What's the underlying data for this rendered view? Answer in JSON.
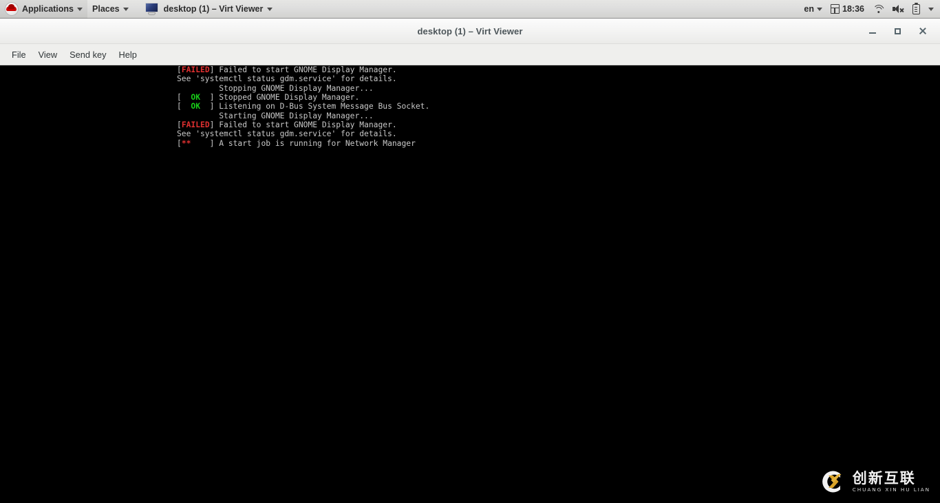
{
  "panel": {
    "logo_icon": "redhat-icon",
    "applications_label": "Applications",
    "places_label": "Places",
    "taskbar": {
      "icon": "monitor-icon",
      "label": "desktop (1) – Virt Viewer"
    },
    "tray": {
      "language": "en",
      "calendar_icon": "calendar-icon",
      "clock": "18:36",
      "wifi_icon": "wifi-icon",
      "volume_icon": "speaker-muted-icon",
      "battery_icon": "battery-icon",
      "menu_icon": "chevron-down-icon"
    }
  },
  "window": {
    "title": "desktop (1) – Virt Viewer",
    "controls": {
      "minimize": "minimize-icon",
      "maximize": "maximize-icon",
      "close": "close-icon"
    },
    "menus": [
      {
        "label": "File"
      },
      {
        "label": "View"
      },
      {
        "label": "Send key"
      },
      {
        "label": "Help"
      }
    ]
  },
  "console": {
    "lines": [
      {
        "segments": [
          {
            "text": "[",
            "style": "plain"
          },
          {
            "text": "FAILED",
            "style": "failed"
          },
          {
            "text": "] Failed to start GNOME Display Manager.",
            "style": "plain"
          }
        ]
      },
      {
        "segments": [
          {
            "text": "See 'systemctl status gdm.service' for details.",
            "style": "plain"
          }
        ]
      },
      {
        "segments": [
          {
            "text": "         Stopping GNOME Display Manager...",
            "style": "plain"
          }
        ]
      },
      {
        "segments": [
          {
            "text": "[  ",
            "style": "plain"
          },
          {
            "text": "OK",
            "style": "ok"
          },
          {
            "text": "  ] Stopped GNOME Display Manager.",
            "style": "plain"
          }
        ]
      },
      {
        "segments": [
          {
            "text": "[  ",
            "style": "plain"
          },
          {
            "text": "OK",
            "style": "ok"
          },
          {
            "text": "  ] Listening on D-Bus System Message Bus Socket.",
            "style": "plain"
          }
        ]
      },
      {
        "segments": [
          {
            "text": "         Starting GNOME Display Manager...",
            "style": "plain"
          }
        ]
      },
      {
        "segments": [
          {
            "text": "[",
            "style": "plain"
          },
          {
            "text": "FAILED",
            "style": "failed"
          },
          {
            "text": "] Failed to start GNOME Display Manager.",
            "style": "plain"
          }
        ]
      },
      {
        "segments": [
          {
            "text": "See 'systemctl status gdm.service' for details.",
            "style": "plain"
          }
        ]
      },
      {
        "segments": [
          {
            "text": "[",
            "style": "plain"
          },
          {
            "text": "**",
            "style": "spin"
          },
          {
            "text": "    ] A start job is running for Network Manager",
            "style": "plain"
          }
        ]
      }
    ]
  },
  "watermark": {
    "mark_icon": "cx-logo-icon",
    "chinese": "创新互联",
    "pinyin": "CHUANG XIN HU LIAN"
  },
  "colors": {
    "console_bg": "#000000",
    "console_fg": "#c8c8c8",
    "failed": "#e03030",
    "ok": "#19d219",
    "panel_bg": "#dedede",
    "logo_gold": "#d9a328"
  }
}
